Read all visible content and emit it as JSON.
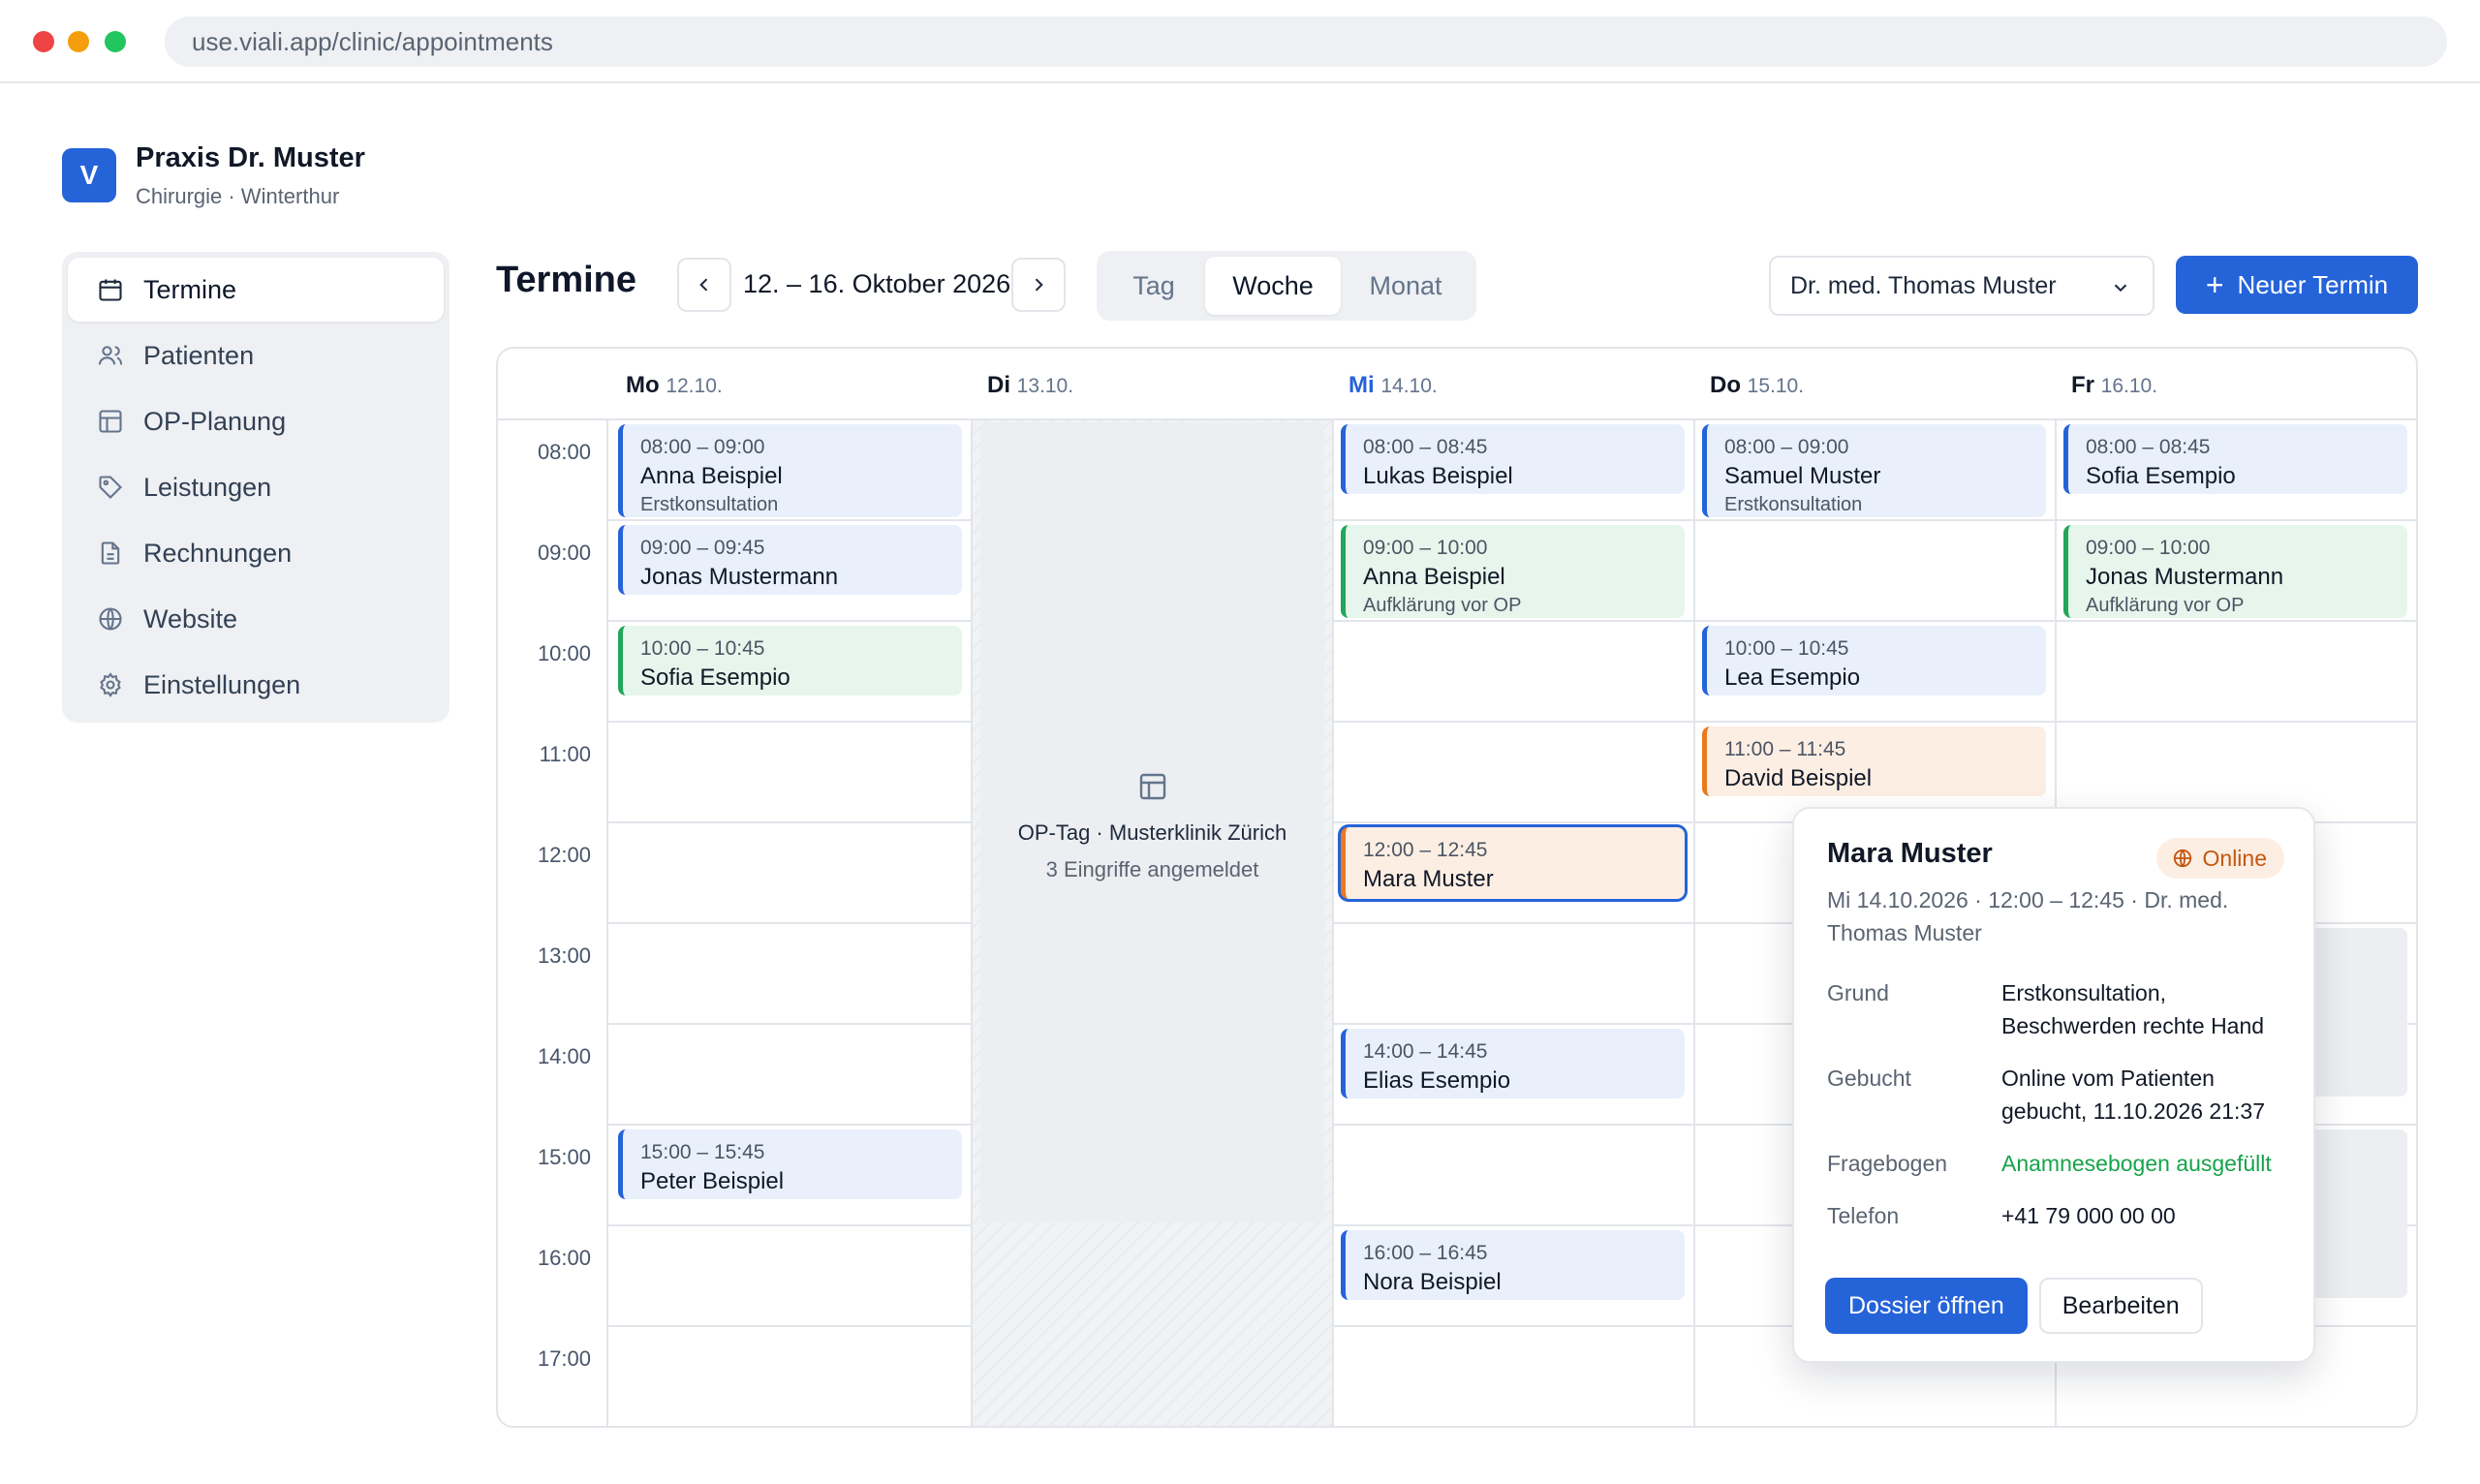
{
  "browser": {
    "url": "use.viali.app/clinic/appointments"
  },
  "brand": {
    "logo": "V",
    "name": "Praxis Dr. Muster",
    "subtitle": "Chirurgie · Winterthur"
  },
  "sidebar": {
    "items": [
      {
        "label": "Termine",
        "icon": "calendar-icon",
        "active": true
      },
      {
        "label": "Patienten",
        "icon": "users-icon"
      },
      {
        "label": "OP-Planung",
        "icon": "layout-icon"
      },
      {
        "label": "Leistungen",
        "icon": "tag-icon"
      },
      {
        "label": "Rechnungen",
        "icon": "file-text-icon"
      },
      {
        "label": "Website",
        "icon": "globe-icon"
      },
      {
        "label": "Einstellungen",
        "icon": "gear-icon"
      }
    ]
  },
  "toolbar": {
    "title": "Termine",
    "date_range": "12. – 16. Oktober 2026",
    "views": [
      "Tag",
      "Woche",
      "Monat"
    ],
    "active_view": "Woche",
    "doctor": "Dr. med. Thomas Muster",
    "new_label": "Neuer Termin"
  },
  "calendar": {
    "days": [
      {
        "day": "Mo",
        "date": "12.10."
      },
      {
        "day": "Di",
        "date": "13.10."
      },
      {
        "day": "Mi",
        "date": "14.10.",
        "today": true
      },
      {
        "day": "Do",
        "date": "15.10."
      },
      {
        "day": "Fr",
        "date": "16.10."
      }
    ],
    "hours": [
      "08:00",
      "09:00",
      "10:00",
      "11:00",
      "12:00",
      "13:00",
      "14:00",
      "15:00",
      "16:00",
      "17:00"
    ],
    "op_day": {
      "title": "OP-Tag · Musterklinik Zürich",
      "subtitle": "3 Eingriffe angemeldet"
    },
    "events": [
      {
        "time": "08:00 – 09:00",
        "name": "Anna Beispiel",
        "sub": "Erstkonsultation",
        "color": "blue"
      },
      {
        "time": "09:00 – 09:45",
        "name": "Jonas Mustermann",
        "color": "blue"
      },
      {
        "time": "10:00 – 10:45",
        "name": "Sofia Esempio",
        "color": "green"
      },
      {
        "time": "15:00 – 15:45",
        "name": "Peter Beispiel",
        "color": "blue"
      },
      {
        "time": "08:00 – 08:45",
        "name": "Lukas Beispiel",
        "color": "blue"
      },
      {
        "time": "09:00 – 10:00",
        "name": "Anna Beispiel",
        "sub": "Aufklärung vor OP",
        "color": "green"
      },
      {
        "time": "12:00 – 12:45",
        "name": "Mara Muster",
        "color": "orange",
        "selected": true
      },
      {
        "time": "14:00 – 14:45",
        "name": "Elias Esempio",
        "color": "blue"
      },
      {
        "time": "16:00 – 16:45",
        "name": "Nora Beispiel",
        "color": "blue"
      },
      {
        "time": "08:00 – 09:00",
        "name": "Samuel Muster",
        "sub": "Erstkonsultation",
        "color": "blue"
      },
      {
        "time": "10:00 – 10:45",
        "name": "Lea Esempio",
        "color": "blue"
      },
      {
        "time": "11:00 – 11:45",
        "name": "David Beispiel",
        "color": "orange"
      },
      {
        "time": "08:00 – 08:45",
        "name": "Sofia Esempio",
        "color": "blue"
      },
      {
        "time": "09:00 – 10:00",
        "name": "Jonas Mustermann",
        "sub": "Aufklärung vor OP",
        "color": "green"
      }
    ]
  },
  "popup": {
    "name": "Mara Muster",
    "badge": "Online",
    "meta": "Mi 14.10.2026 · 12:00 – 12:45 · Dr. med. Thomas Muster",
    "details": [
      {
        "key": "Grund",
        "value": "Erstkonsultation, Beschwerden rechte Hand"
      },
      {
        "key": "Gebucht",
        "value": "Online vom Patienten gebucht, 11.10.2026 21:37"
      },
      {
        "key": "Fragebogen",
        "value": "Anamnesebogen ausgefüllt"
      },
      {
        "key": "Telefon",
        "value": "+41 79 000 00 00"
      }
    ],
    "primary": "Dossier öffnen",
    "secondary": "Bearbeiten"
  },
  "colors": {
    "accent": "#2563d9",
    "green": "#21a65a",
    "orange": "#ea7a1f"
  }
}
